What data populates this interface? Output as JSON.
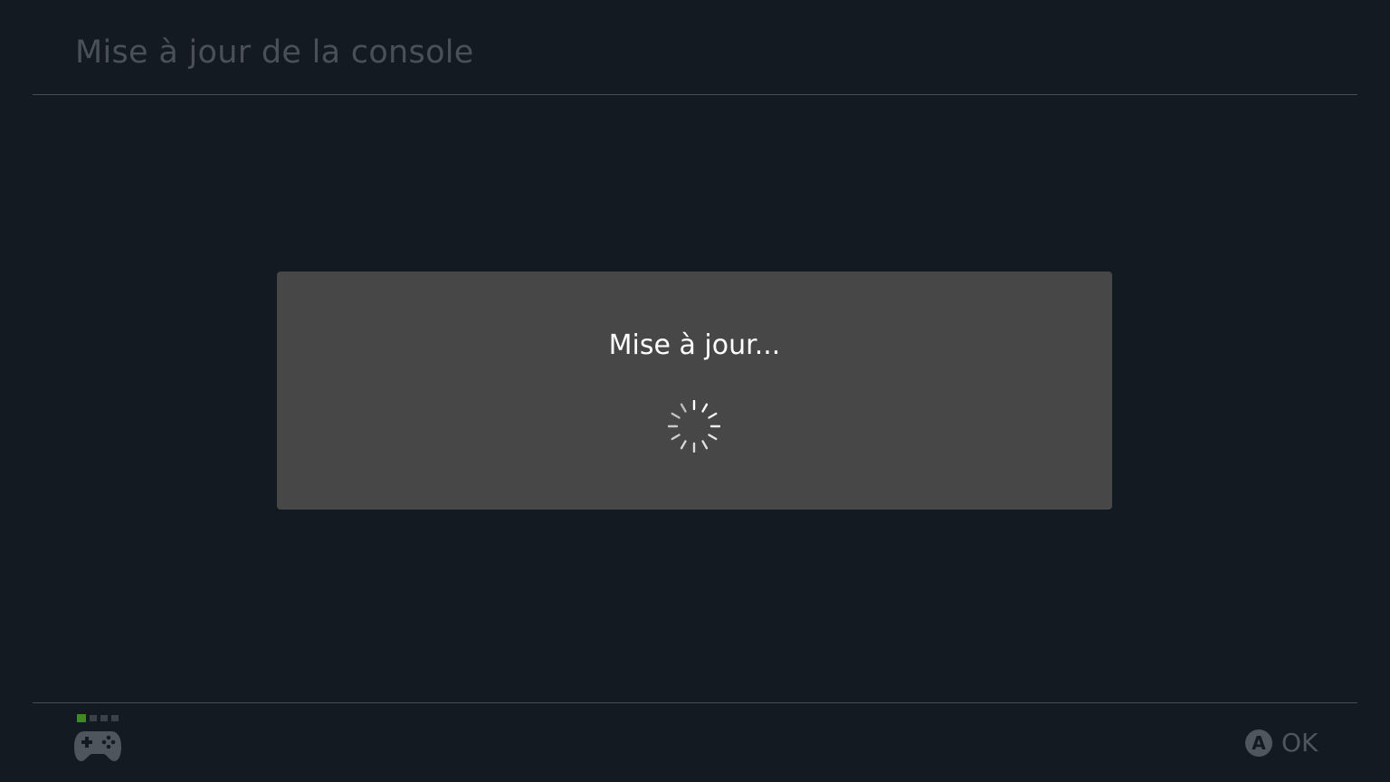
{
  "header": {
    "title": "Mise à jour de la console"
  },
  "dialog": {
    "message": "Mise à jour...",
    "indicator_icon": "loading-spinner-icon"
  },
  "footer": {
    "controller": {
      "icon": "gamepad-icon",
      "active_player": 1,
      "player_slots": 4
    },
    "actions": [
      {
        "button_glyph": "A",
        "label": "OK"
      }
    ]
  },
  "colors": {
    "background": "#141a21",
    "dialog_background": "#474747",
    "title_text": "#4a5058",
    "dialog_text": "#ffffff",
    "player_indicator_active": "#3f8a24",
    "hint_text": "#50565d"
  }
}
